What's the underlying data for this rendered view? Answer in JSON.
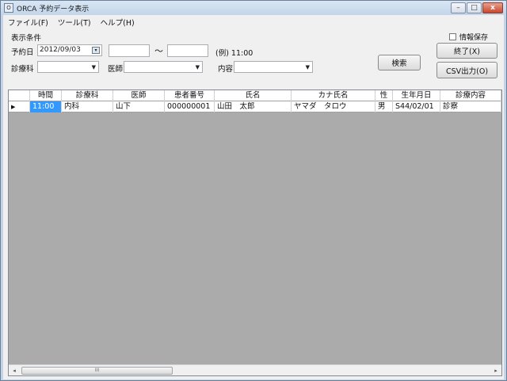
{
  "window": {
    "title": "ORCA 予約データ表示",
    "icon_label": "O",
    "minimize_glyph": "–",
    "maximize_glyph": "□",
    "close_glyph": "x"
  },
  "menu": [
    "ファイル(F)",
    "ツール(T)",
    "ヘルプ(H)"
  ],
  "criteria": {
    "section_label": "表示条件",
    "date_label": "予約日",
    "date_value": "2012/09/03",
    "time_from": "",
    "tilde": "～",
    "time_to": "",
    "time_example": "(例) 11:00",
    "department_label": "診療科",
    "department_value": "",
    "doctor_label": "医師",
    "doctor_value": "",
    "content_label": "内容",
    "content_value": ""
  },
  "buttons": {
    "search": "検索",
    "exit": "終了(X)",
    "csv": "CSV出力(O)"
  },
  "save_info": {
    "label": "情報保存",
    "checked": false
  },
  "grid": {
    "columns": [
      "時間",
      "診療科",
      "医師",
      "患者番号",
      "氏名",
      "カナ氏名",
      "性",
      "生年月日",
      "診療内容"
    ],
    "rows": [
      [
        "11:00",
        "内科",
        "山下",
        "000000001",
        "山田　太郎",
        "ヤマダ　タロウ",
        "男",
        "S44/02/01",
        "診察"
      ]
    ],
    "row_indicator": "▶",
    "scroll_thumb_grip": "III",
    "scroll_left": "◂",
    "scroll_right": "▸"
  },
  "icons": {
    "calendar": "calendar-icon",
    "dropdown": "chevron-down-icon"
  }
}
